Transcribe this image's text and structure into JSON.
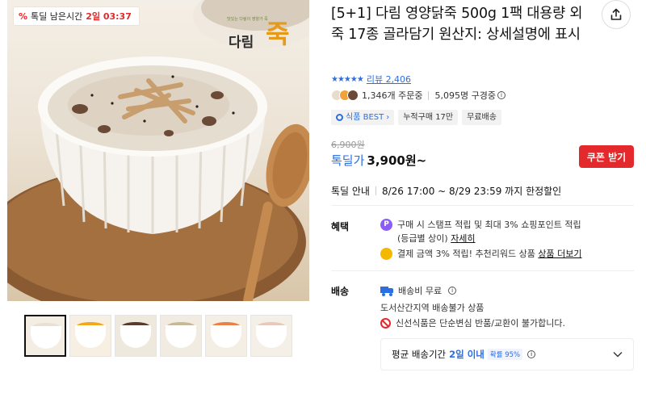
{
  "timer": {
    "prefix": "%",
    "label": "톡딜 남은시간",
    "time": "2일 03:37"
  },
  "brand_logo": {
    "small": "맛있는 다림이 영양가 죽",
    "name": "다림",
    "mark": "죽"
  },
  "title": "[5+1] 다림 영양닭죽 500g 1팩 대용량 외 죽 17종 골라담기 원산지: 상세설명에 표시",
  "rating": {
    "stars": 4.5,
    "review_label": "리뷰 2,406"
  },
  "stats": {
    "orders": "1,346개 주문중",
    "subscribers": "5,095명 구경중"
  },
  "tags": [
    {
      "label": "식품 BEST",
      "suffix": "›"
    },
    {
      "label": "누적구매 17만"
    },
    {
      "label": "무료배송"
    }
  ],
  "price": {
    "original": "6,900원",
    "deal_label": "톡딜가",
    "deal_value": "3,900원~",
    "coupon_label": "쿠폰 받기"
  },
  "deal_info": {
    "label": "톡딜 안내",
    "period": "8/26 17:00 ~ 8/29 23:59 까지 한정할인"
  },
  "benefits": {
    "label": "혜택",
    "items": [
      {
        "icon": "point-icon",
        "icon_char": "P",
        "color": "#8b5cf6",
        "line1": "구매 시 스탬프 적립 및 최대 3% 쇼핑포인트 적립",
        "line2": "(등급별 상이)",
        "link": "자세히"
      },
      {
        "icon": "coin-icon",
        "icon_char": "",
        "color": "#f5b800",
        "line1": "결제 금액 3% 적립! 추천리워드 상품",
        "link": "상품 더보기"
      }
    ]
  },
  "shipping": {
    "label": "배송",
    "fee": "배송비 무료",
    "restriction": "도서산간지역 배송불가 상품",
    "notice": "신선식품은 단순변심 반품/교환이 불가합니다.",
    "avg_label": "평균 배송기간",
    "avg_days": "2일 이내",
    "avg_prob": "확률 95%"
  },
  "thumb_colors": [
    {
      "porridge": "#e8e0d2",
      "bg": "#f3ede4"
    },
    {
      "porridge": "#f2a81c",
      "bg": "#f7efe2"
    },
    {
      "porridge": "#5a3a2e",
      "bg": "#efe8dc"
    },
    {
      "porridge": "#c9b79a",
      "bg": "#f1ebe1"
    },
    {
      "porridge": "#e9804a",
      "bg": "#f5eee4"
    },
    {
      "porridge": "#e7c9bc",
      "bg": "#f4efe7"
    }
  ]
}
